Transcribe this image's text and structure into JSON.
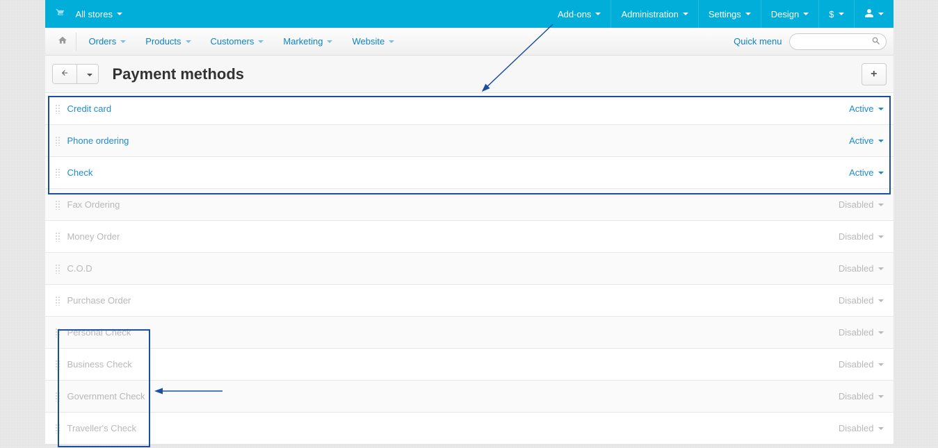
{
  "topbar": {
    "stores_label": "All stores",
    "menu": {
      "addons": "Add-ons",
      "administration": "Administration",
      "settings": "Settings",
      "design": "Design",
      "currency": "$"
    }
  },
  "nav": {
    "orders": "Orders",
    "products": "Products",
    "customers": "Customers",
    "marketing": "Marketing",
    "website": "Website",
    "quick_menu": "Quick menu"
  },
  "page": {
    "title": "Payment methods"
  },
  "status_labels": {
    "active": "Active",
    "disabled": "Disabled"
  },
  "methods": [
    {
      "name": "Credit card",
      "status": "active"
    },
    {
      "name": "Phone ordering",
      "status": "active"
    },
    {
      "name": "Check",
      "status": "active"
    },
    {
      "name": "Fax Ordering",
      "status": "disabled"
    },
    {
      "name": "Money Order",
      "status": "disabled"
    },
    {
      "name": "C.O.D",
      "status": "disabled"
    },
    {
      "name": "Purchase Order",
      "status": "disabled"
    },
    {
      "name": "Personal Check",
      "status": "disabled"
    },
    {
      "name": "Business Check",
      "status": "disabled"
    },
    {
      "name": "Government Check",
      "status": "disabled"
    },
    {
      "name": "Traveller's Check",
      "status": "disabled"
    }
  ]
}
